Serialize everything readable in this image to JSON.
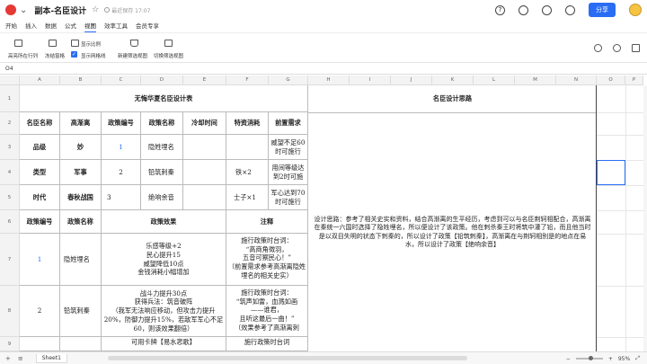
{
  "titlebar": {
    "doc_title": "副本-名臣设计",
    "save_status": "最近保存 17:07",
    "share_label": "分享"
  },
  "menu": [
    "开始",
    "插入",
    "数据",
    "公式",
    "视图",
    "效率工具",
    "会员专享"
  ],
  "menu_active": "视图",
  "ribbon": {
    "highlight": "高亮所在行列",
    "freeze": "冻结窗格",
    "display_ratio": "显示比例",
    "show_gridlines": "显示网格线",
    "new_filter_view": "新建筛选视图",
    "switch_filter_view": "切换筛选视图"
  },
  "formula_bar": {
    "cell_ref": "O4"
  },
  "columns": [
    "A",
    "B",
    "C",
    "D",
    "E",
    "F",
    "G",
    "H",
    "I",
    "J",
    "K",
    "L",
    "M",
    "N",
    "O",
    "P"
  ],
  "rows": [
    "1",
    "2",
    "3",
    "4",
    "5",
    "6",
    "7",
    "8",
    "9"
  ],
  "table": {
    "title": "无悔华夏名臣设计表",
    "right_title": "名臣设计思路",
    "headers": [
      "名臣名称",
      "高渐离",
      "政策编号",
      "政策名称",
      "冷却时间",
      "特资消耗",
      "前置需求"
    ],
    "r3": {
      "a": "品级",
      "b": "妙",
      "c": "1",
      "d": "隐姓埋名",
      "g": "威望不足60时可施行"
    },
    "r4": {
      "a": "类型",
      "b": "军事",
      "c": "2",
      "d": "铅筑刺秦",
      "f": "铁×2",
      "g": "用间等级达到2时可施"
    },
    "r5": {
      "a": "时代",
      "b": "春秋战国",
      "c": "3",
      "d": "绝响余音",
      "f": "士子×1",
      "g": "军心达到70时可施行"
    },
    "r6": {
      "a": "政策编号",
      "b": "政策名称",
      "c": "政策效果",
      "f": "注释"
    },
    "r7": {
      "a": "1",
      "b": "隐姓埋名",
      "effect": "乐感等级+2\n民心提升15\n威望降低10点\n金钱消耗小幅增加",
      "note": "施行政策时台词：\n“高商角徵羽，\n五音可察民心！”\n（前置需求参考高渐离隐姓埋名的相关史实）"
    },
    "r8": {
      "a": "2",
      "b": "铅筑刺秦",
      "effect": "战斗力提升30点\n获得兵法：筑音破阵\n（我军无法响应移动，但攻击力提升20%，防御力提升15%，若敌军军心不足60，则该效果翻倍）",
      "note": "施行政策时台词：\n“筑声如雷，血溅如画\n——谁君，\n且听这最后一曲！”\n（效果参考了高渐离刺"
    },
    "r9": {
      "effect": "可用卡牌【易水悲歌】",
      "note": "施行政策时台词"
    },
    "design_text": "设计思路：参考了相关史实和资料，结合高渐离的生平经历，考虑到可以与名臣荆轲相配合，高渐离在秦统一六国时选择了隐姓埋名，所以便设计了该政策。他在刺杀秦王时将筑中灌了铅，而且他当时是以双目失明的状态下刺秦的，所以设计了政策【铅筑刺秦】，高渐离在与荆轲相别是的地点在易水，所以设计了政策【绝响余音】"
  },
  "sheet_tab": "Sheet1",
  "zoom": "95%"
}
